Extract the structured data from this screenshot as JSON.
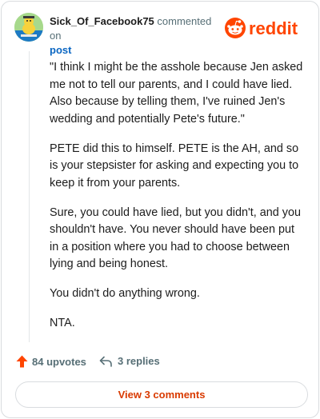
{
  "comment": {
    "username": "Sick_Of_Facebook75",
    "action": "commented on",
    "target": "post",
    "paragraphs": [
      "\"I think I might be the asshole because Jen asked me not to tell our parents, and I could have lied. Also because by telling them, I've ruined Jen's wedding and potentially Pete's future.\"",
      "PETE did this to himself. PETE is the AH, and so is your stepsister for asking and expecting you to keep it from your parents.",
      "Sure, you could have lied, but you didn't, and you shouldn't have. You never should have been put in a position where you had to choose between lying and being honest.",
      "You didn't do anything wrong.",
      "NTA."
    ]
  },
  "brand": {
    "logo_text": "reddit",
    "color": "#ff4500"
  },
  "actions": {
    "upvotes": "84 upvotes",
    "replies": "3 replies"
  },
  "footer": {
    "view_label": "View 3 comments"
  },
  "icons": {
    "upvote": "upvote-arrow-icon",
    "reply": "reply-arrow-icon",
    "avatar": "snoo-avatar",
    "logo": "reddit-logo"
  },
  "colors": {
    "accent": "#d93a00",
    "upvote": "#ff4500",
    "link": "#0a66c2",
    "muted": "#576f76"
  }
}
